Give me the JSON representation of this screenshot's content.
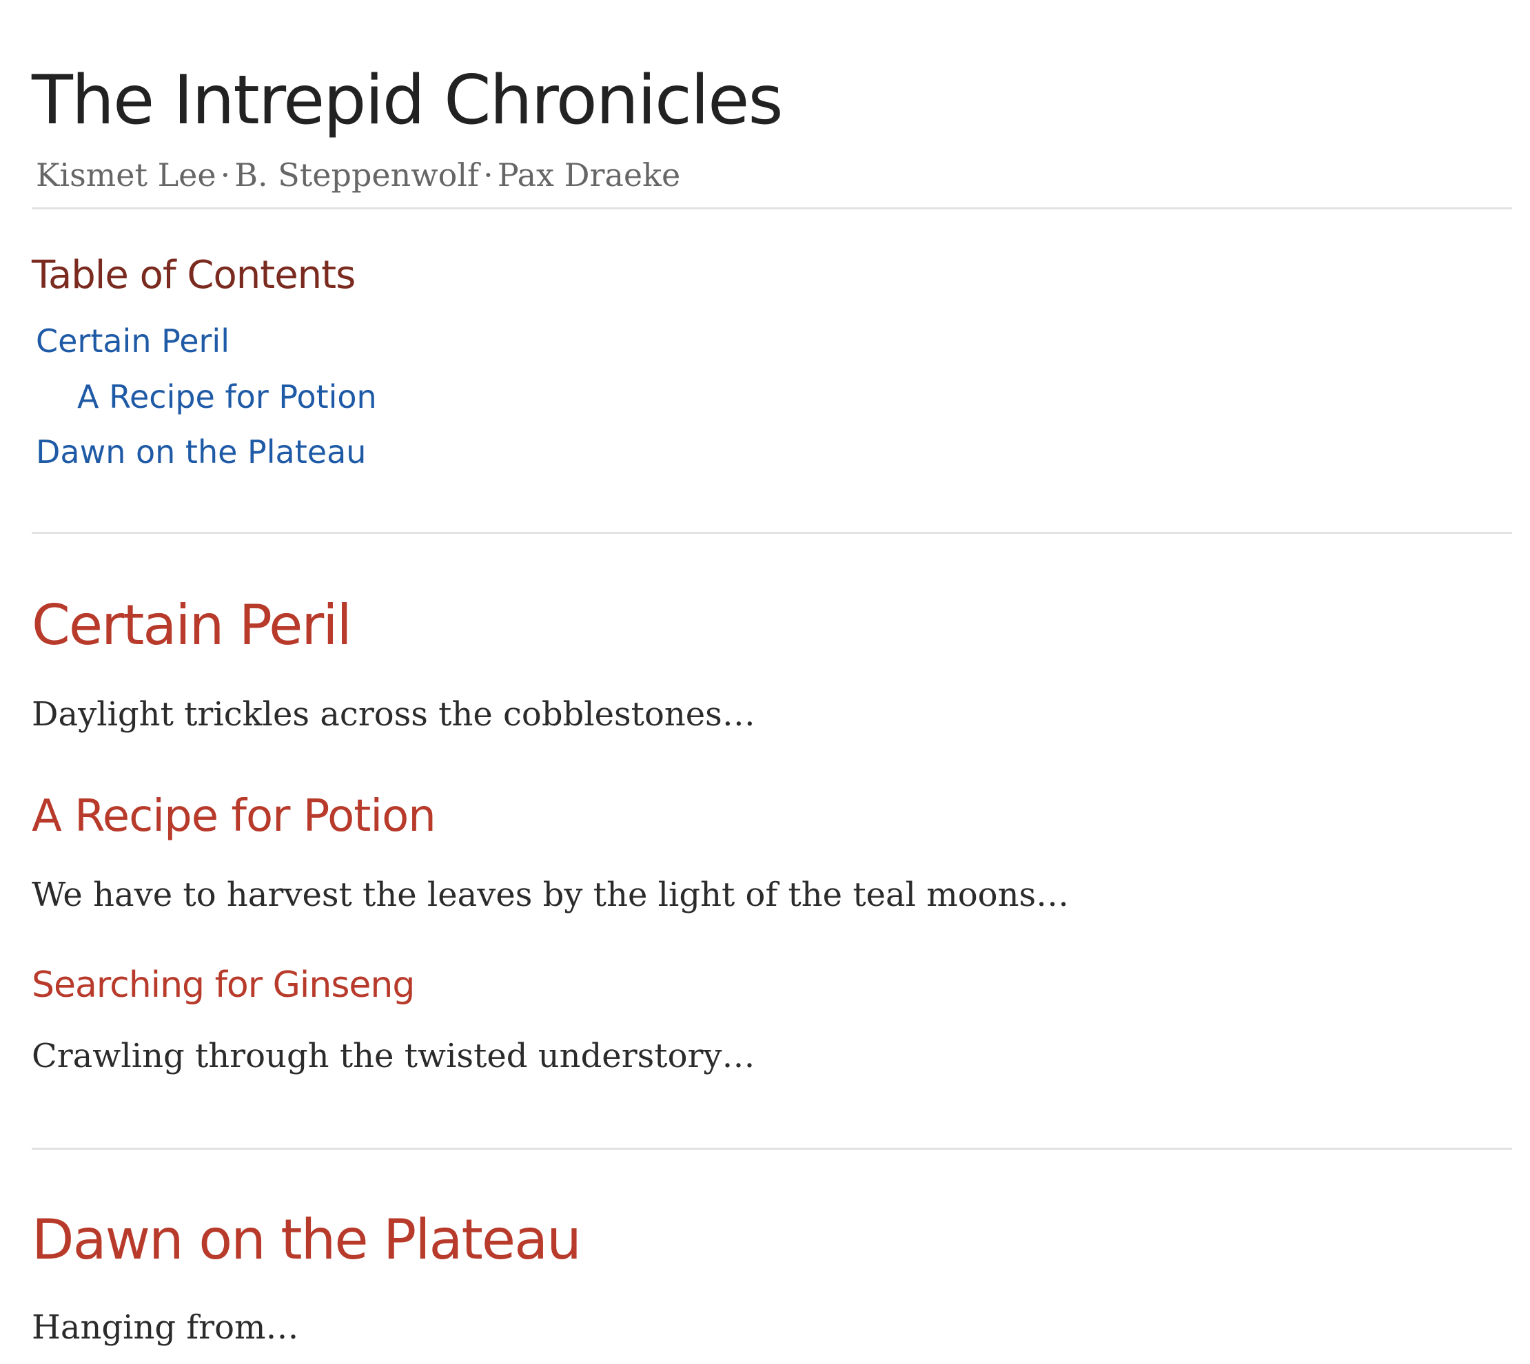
{
  "header": {
    "title": "The Intrepid Chronicles",
    "authors": [
      "Kismet Lee",
      "B. Steppenwolf",
      "Pax Draeke"
    ],
    "author_separator": "·"
  },
  "toc": {
    "heading": "Table of Contents",
    "items": [
      {
        "label": "Certain Peril",
        "level": 1
      },
      {
        "label": "A Recipe for Potion",
        "level": 2
      },
      {
        "label": "Dawn on the Plateau",
        "level": 1
      }
    ]
  },
  "sections": [
    {
      "heading": "Certain Peril",
      "text": "Daylight trickles across the cobblestones…",
      "subsections": [
        {
          "heading": "A Recipe for Potion",
          "text": "We have to harvest the leaves by the light of the teal moons…",
          "subsections": [
            {
              "heading": "Searching for Ginseng",
              "text": "Crawling through the twisted understory…"
            }
          ]
        }
      ]
    },
    {
      "heading": "Dawn on the Plateau",
      "text": "Hanging from…"
    }
  ],
  "colors": {
    "title": "#222222",
    "authors": "#666666",
    "toc_heading": "#7a2a1e",
    "link": "#1f5aa6",
    "section_heading": "#b83a2b",
    "body_text": "#2b2b2b",
    "rule": "#e2e2e2"
  }
}
